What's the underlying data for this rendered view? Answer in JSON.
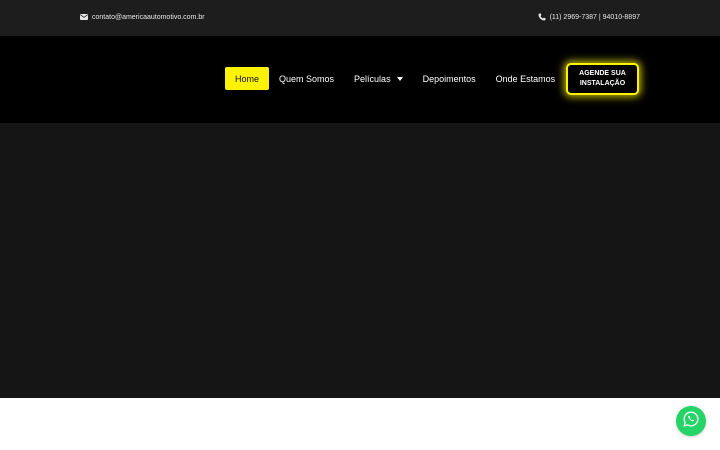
{
  "topbar": {
    "email": "contato@americaautomotivo.com.br",
    "email_icon": "envelope-icon",
    "phone": "(11) 2969-7387 | 94010-8897",
    "phone_icon": "phone-icon"
  },
  "nav": {
    "items": [
      {
        "label": "Home",
        "active": true
      },
      {
        "label": "Quem Somos"
      },
      {
        "label": "Películas",
        "has_dropdown": true
      },
      {
        "label": "Depoimentos"
      },
      {
        "label": "Onde Estamos"
      }
    ],
    "cta_line1": "AGENDE SUA",
    "cta_line2": "INSTALAÇÃO"
  },
  "floating": {
    "whatsapp_icon": "whatsapp-icon"
  },
  "colors": {
    "accent": "#fcf203",
    "topbar_bg": "#1d1d1d",
    "nav_bg": "#000000",
    "hero_bg": "#151515",
    "whatsapp": "#25d366"
  }
}
